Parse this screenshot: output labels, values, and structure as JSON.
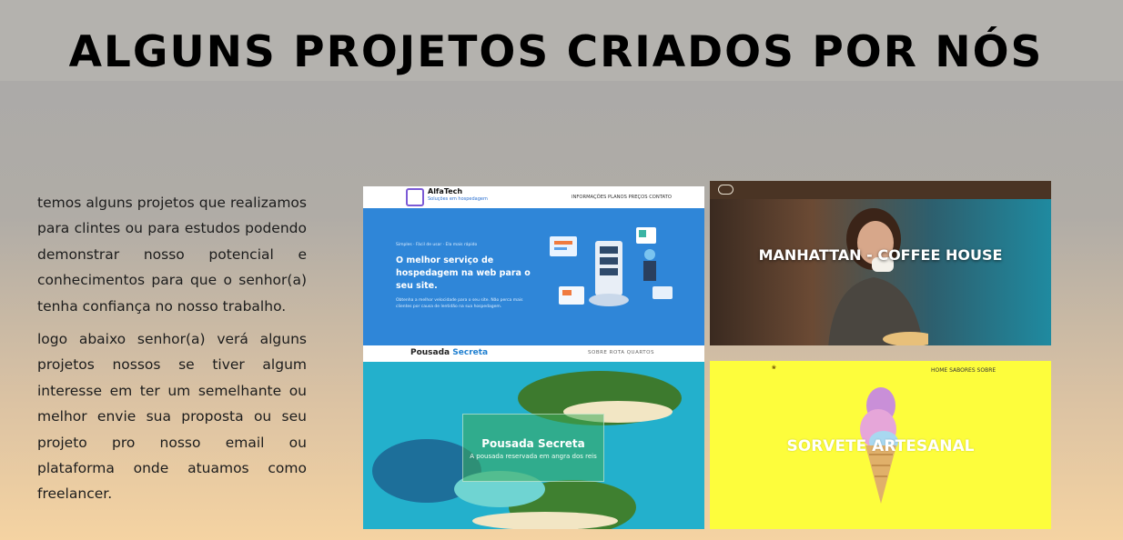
{
  "title": "ALGUNS PROJETOS CRIADOS POR NÓS",
  "intro": {
    "paragraph1": "temos alguns projetos que realizamos para clintes ou para estudos podendo demonstrar nosso potencial e conhecimentos para que o senhor(a) tenha confiança no nosso trabalho.",
    "paragraph2": "logo abaixo senhor(a) verá alguns projetos nossos se tiver algum interesse em ter um semelhante ou melhor envie sua proposta ou seu projeto pro nosso email ou plataforma onde atuamos como freelancer."
  },
  "projects": {
    "alfatech": {
      "brand": "AlfaTech",
      "brand_sub": "Soluções em hospedagem",
      "nav": "INFORMAÇÕES  PLANOS  PREÇOS  CONTATO",
      "tagline_small": "Simples · Fácil de usar · Ela mais rápido",
      "hero": "O melhor serviço de hospedagem na web para o seu site.",
      "hero_sub": "Obtenha a melhor velocidade para o seu site. Não perca mais clientes por causa de lentidão na sua hospedagem."
    },
    "coffee": {
      "caption": "MANHATTAN - COFFEE HOUSE"
    },
    "pousada": {
      "brand_first": "Pousada",
      "brand_second": "Secreta",
      "nav": "SOBRE  ROTA  QUARTOS",
      "overlay_title": "Pousada Secreta",
      "overlay_sub": "A pousada reservada em angra dos reis"
    },
    "sorvete": {
      "nav": "HOME  SABORES  SOBRE",
      "caption": "SORVETE ARTESANAL"
    }
  },
  "colors": {
    "alfatech_blue": "#2f86d8",
    "sorvete_yellow": "#fdfd3c",
    "coffee_bar": "#4a3424"
  }
}
